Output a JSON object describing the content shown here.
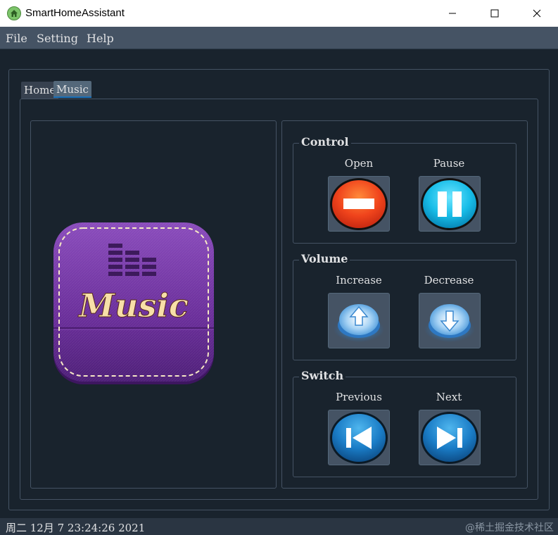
{
  "window": {
    "title": "SmartHomeAssistant",
    "app_icon": "home-icon",
    "controls": [
      "minimize-icon",
      "maximize-icon",
      "close-icon"
    ]
  },
  "menu": [
    "File",
    "Setting",
    "Help"
  ],
  "tabs": [
    {
      "label": "Home",
      "selected": false
    },
    {
      "label": "Music",
      "selected": true
    }
  ],
  "artwork": {
    "text": "Music",
    "icon": "music-equalizer-icon"
  },
  "groups": {
    "control": {
      "title": "Control",
      "buttons": [
        {
          "label": "Open",
          "icon": "stop-icon"
        },
        {
          "label": "Pause",
          "icon": "pause-icon"
        }
      ]
    },
    "volume": {
      "title": "Volume",
      "buttons": [
        {
          "label": "Increase",
          "icon": "arrow-up-icon"
        },
        {
          "label": "Decrease",
          "icon": "arrow-down-icon"
        }
      ]
    },
    "switch": {
      "title": "Switch",
      "buttons": [
        {
          "label": "Previous",
          "icon": "skip-previous-icon"
        },
        {
          "label": "Next",
          "icon": "skip-next-icon"
        }
      ]
    }
  },
  "status": {
    "datetime": "周二 12月 7 23:24:26 2021",
    "watermark": "@稀土掘金技术社区"
  },
  "colors": {
    "background": "#19232d",
    "menubar": "#455364",
    "border": "#455364",
    "accent": "#1a72bb",
    "artwork_purple": "#6a2e9a"
  }
}
